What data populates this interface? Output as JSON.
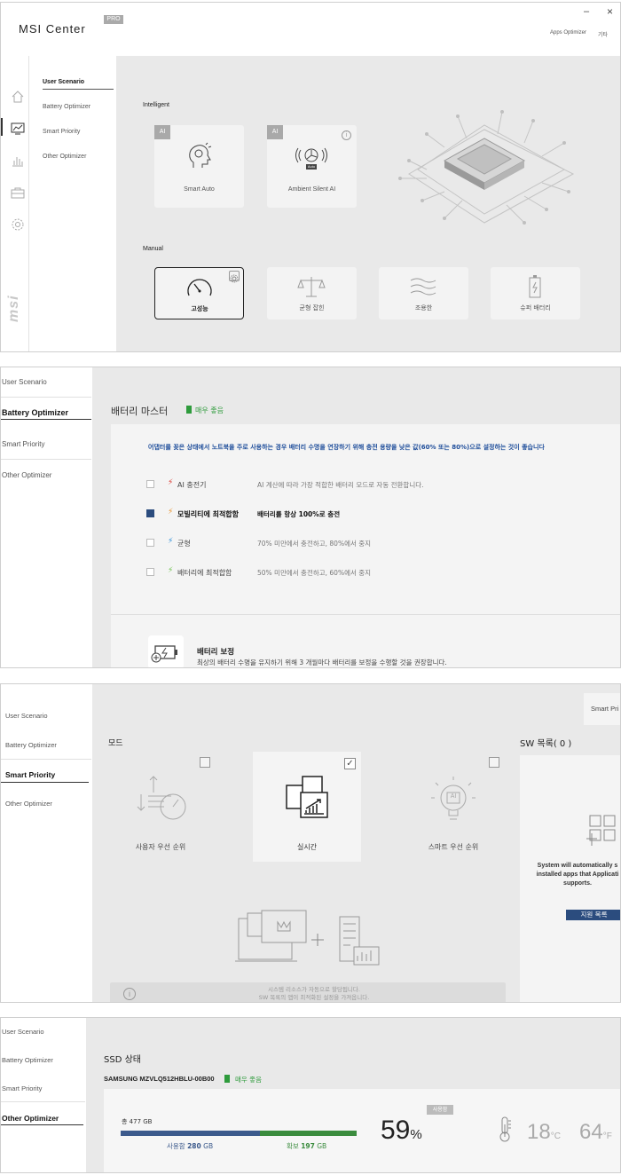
{
  "window": {
    "title": "MSI Center",
    "pro_badge": "PRO",
    "minimize": "–",
    "close": "×",
    "apps_optimizer": "Apps Optimizer",
    "other": "기타",
    "brand_logo": "msi"
  },
  "nav": {
    "items": [
      "User Scenario",
      "Battery Optimizer",
      "Smart Priority",
      "Other Optimizer"
    ],
    "rail_icons": [
      "home-icon",
      "monitor-chart-icon",
      "bar-chart-icon",
      "toolbox-icon",
      "gear-icon"
    ]
  },
  "user_scenario": {
    "intelligent_title": "Intelligent",
    "ai_badge": "AI",
    "smart_auto": "Smart Auto",
    "ambient_silent": "Ambient Silent AI",
    "fan_label": "Auto",
    "manual_title": "Manual",
    "modes": [
      "고성능",
      "균형 잡힌",
      "조용한",
      "슈퍼 배터리"
    ]
  },
  "battery": {
    "title": "배터리 마스터",
    "status": "매우 좋음",
    "notice": "어댑터를 꽂은 상태에서 노트북을 주로 사용하는 경우 배터리 수명을 연장하기 위해 충전 용량을 낮은 값(60% 또는 80%)으로 설정하는 것이 좋습니다",
    "options": [
      {
        "name": "AI 충전기",
        "desc": "AI 계산에 따라 가장 적합한 배터리 모드로 자동 전환합니다.",
        "checked": false,
        "bolt": "#d9342b"
      },
      {
        "name": "모빌리티에 최적합함",
        "desc": "배터리를 항상 100%로 충전",
        "checked": true,
        "bolt": "#e8922a"
      },
      {
        "name": "균형",
        "desc": "70% 미만에서 충전하고, 80%에서 중지",
        "checked": false,
        "bolt": "#2b8fd9"
      },
      {
        "name": "배터리에 최적합함",
        "desc": "50% 미만에서 충전하고, 60%에서 중지",
        "checked": false,
        "bolt": "#6cc24a"
      }
    ],
    "calibration_title": "배터리 보정",
    "calibration_desc": "최상의 배터리 수명을 유지하기 위해 3 개월마다 배터리를 보정을 수행할 것을 권장합니다."
  },
  "smart_priority": {
    "mode_title": "모드",
    "modes": [
      {
        "label": "사용자 우선 순위",
        "checked": false
      },
      {
        "label": "실시간",
        "checked": true
      },
      {
        "label": "스마트 우선 순위",
        "checked": false
      }
    ],
    "top_button": "Smart Pri",
    "sw_list_title": "SW 목록( 0 )",
    "sw_note": "System will automatically s\ninstalled apps that Applicati\nsupports.",
    "support_list": "지원 목록",
    "info": "시스템 리소스가 자동으로 할당됩니다.\nSW 목록의 앱이 최적화된 설정을 가져옵니다."
  },
  "other_optimizer": {
    "ssd_title": "SSD 상태",
    "model": "SAMSUNG MZVLQ512HBLU-00B00",
    "status": "매우 좋음",
    "total": "총 477 GB",
    "used_label": "사용함",
    "used_value": "280",
    "free_label": "확보",
    "free_value": "197",
    "unit": "GB",
    "used_fraction": 0.59,
    "percent": "59",
    "percent_sign": "%",
    "usage_tag": "사용함",
    "temp_c": "18",
    "temp_c_unit": "°C",
    "temp_f": "64",
    "temp_f_unit": "°F",
    "colors": {
      "used": "#3c5a8c",
      "free": "#3b8c3e",
      "accent": "#1f4e9b",
      "good": "#2e9b3c"
    }
  }
}
